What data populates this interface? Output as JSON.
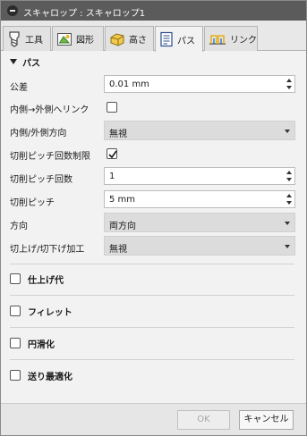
{
  "window": {
    "title": "スキャロップ : スキャロップ1"
  },
  "tabs": [
    {
      "label": "工具",
      "icon": "tool-icon",
      "active": false
    },
    {
      "label": "図形",
      "icon": "geometry-icon",
      "active": false
    },
    {
      "label": "高さ",
      "icon": "heights-icon",
      "active": false
    },
    {
      "label": "パス",
      "icon": "passes-icon",
      "active": true
    },
    {
      "label": "リンク",
      "icon": "linking-icon",
      "active": false
    }
  ],
  "passes": {
    "heading": "パス",
    "tolerance": {
      "label": "公差",
      "value": "0.01 mm"
    },
    "inside_to_outside": {
      "label": "内側→外側へリンク",
      "checked": false
    },
    "direction_io": {
      "label": "内側/外側方向",
      "value": "無視"
    },
    "stepover_limit": {
      "label": "切削ピッチ回数制限",
      "checked": true
    },
    "stepover_count": {
      "label": "切削ピッチ回数",
      "value": "1"
    },
    "stepover": {
      "label": "切削ピッチ",
      "value": "5 mm"
    },
    "direction": {
      "label": "方向",
      "value": "両方向"
    },
    "cut_mode": {
      "label": "切上げ/切下げ加工",
      "value": "無視"
    }
  },
  "groups": {
    "stock_to_leave": {
      "label": "仕上げ代",
      "checked": false
    },
    "fillets": {
      "label": "フィレット",
      "checked": false
    },
    "smoothing": {
      "label": "円滑化",
      "checked": false
    },
    "feed_optimization": {
      "label": "送り最適化",
      "checked": false
    }
  },
  "footer": {
    "ok_label": "OK",
    "cancel_label": "キャンセル"
  }
}
